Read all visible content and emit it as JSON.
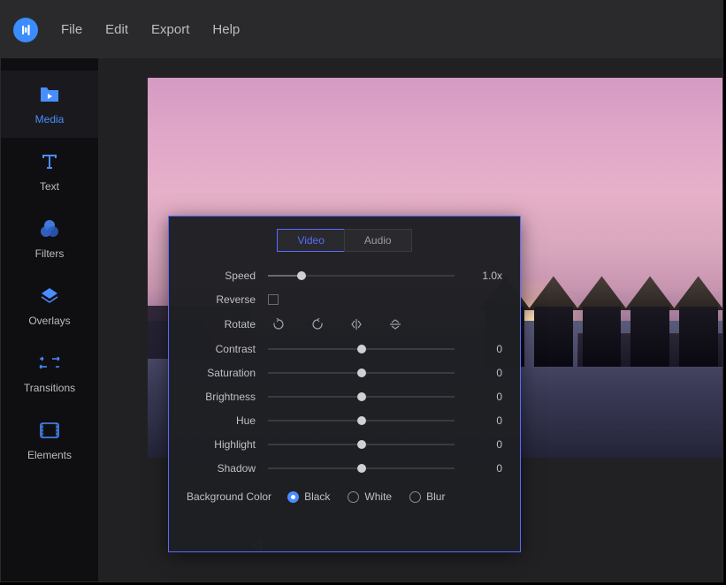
{
  "menubar": {
    "items": [
      "File",
      "Edit",
      "Export",
      "Help"
    ]
  },
  "sidebar": {
    "items": [
      {
        "label": "Media",
        "icon": "folder-play-icon",
        "active": true
      },
      {
        "label": "Text",
        "icon": "text-icon",
        "active": false
      },
      {
        "label": "Filters",
        "icon": "circles-icon",
        "active": false
      },
      {
        "label": "Overlays",
        "icon": "diamond-icon",
        "active": false
      },
      {
        "label": "Transitions",
        "icon": "arrows-icon",
        "active": false
      },
      {
        "label": "Elements",
        "icon": "film-icon",
        "active": false
      }
    ]
  },
  "inspector": {
    "tabs": {
      "video": "Video",
      "audio": "Audio",
      "active": "video"
    },
    "speed": {
      "label": "Speed",
      "value": "1.0x",
      "pos": 18
    },
    "reverse": {
      "label": "Reverse",
      "checked": false
    },
    "rotate": {
      "label": "Rotate"
    },
    "sliders": [
      {
        "label": "Contrast",
        "value": "0",
        "pos": 50
      },
      {
        "label": "Saturation",
        "value": "0",
        "pos": 50
      },
      {
        "label": "Brightness",
        "value": "0",
        "pos": 50
      },
      {
        "label": "Hue",
        "value": "0",
        "pos": 50
      },
      {
        "label": "Highlight",
        "value": "0",
        "pos": 50
      },
      {
        "label": "Shadow",
        "value": "0",
        "pos": 50
      }
    ],
    "bgcolor": {
      "label": "Background Color",
      "options": [
        {
          "label": "Black",
          "checked": true
        },
        {
          "label": "White",
          "checked": false
        },
        {
          "label": "Blur",
          "checked": false
        }
      ]
    }
  }
}
